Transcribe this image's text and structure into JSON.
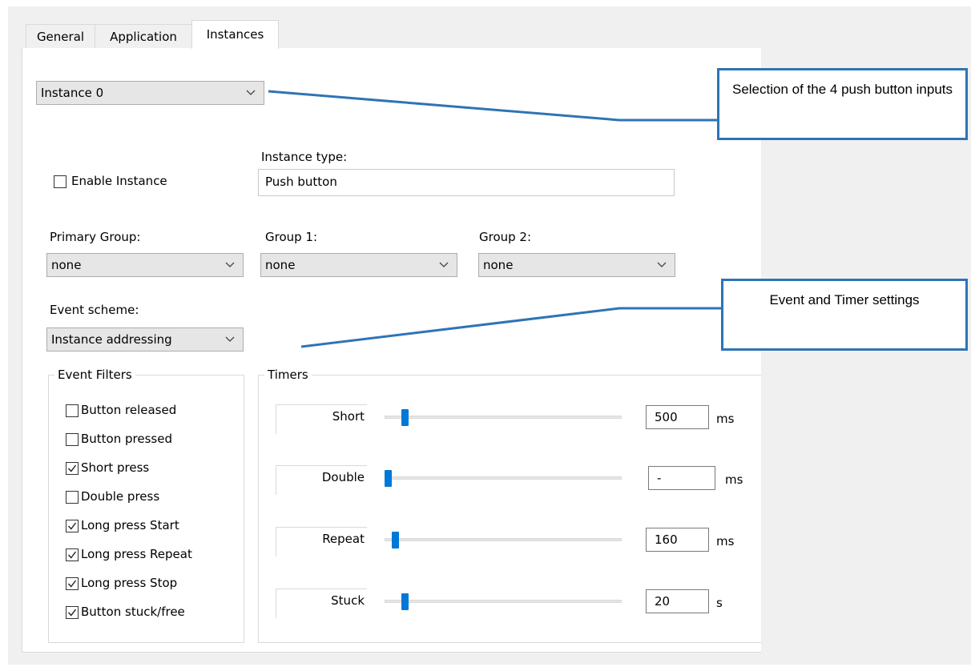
{
  "tabs": [
    {
      "label": "General",
      "active": false
    },
    {
      "label": "Application",
      "active": false
    },
    {
      "label": "Instances",
      "active": true
    }
  ],
  "instance_select": {
    "value": "Instance 0"
  },
  "enable_instance": {
    "label": "Enable Instance",
    "checked": false
  },
  "instance_type": {
    "label": "Instance type:",
    "value": "Push button"
  },
  "groups": {
    "primary": {
      "label": "Primary Group:",
      "value": "none"
    },
    "group1": {
      "label": "Group 1:",
      "value": "none"
    },
    "group2": {
      "label": "Group 2:",
      "value": "none"
    }
  },
  "event_scheme": {
    "label": "Event scheme:",
    "value": "Instance addressing"
  },
  "event_filters": {
    "title": "Event Filters",
    "items": [
      {
        "label": "Button released",
        "checked": false
      },
      {
        "label": "Button pressed",
        "checked": false
      },
      {
        "label": "Short press",
        "checked": true
      },
      {
        "label": "Double press",
        "checked": false
      },
      {
        "label": "Long press Start",
        "checked": true
      },
      {
        "label": "Long press Repeat",
        "checked": true
      },
      {
        "label": "Long press Stop",
        "checked": true
      },
      {
        "label": "Button stuck/free",
        "checked": true
      }
    ]
  },
  "timers": {
    "title": "Timers",
    "items": [
      {
        "label": "Short",
        "value": "500",
        "unit": "ms",
        "slider_fraction": 0.07
      },
      {
        "label": "Double",
        "value": "-",
        "unit": "ms",
        "slider_fraction": 0.0
      },
      {
        "label": "Repeat",
        "value": "160",
        "unit": "ms",
        "slider_fraction": 0.03
      },
      {
        "label": "Stuck",
        "value": "20",
        "unit": "s",
        "slider_fraction": 0.07
      }
    ]
  },
  "callouts": {
    "selection": "Selection of the 4 push button inputs",
    "events": "Event and Timer settings"
  },
  "colors": {
    "accent": "#0078d7",
    "callout_border": "#2e74b5"
  }
}
